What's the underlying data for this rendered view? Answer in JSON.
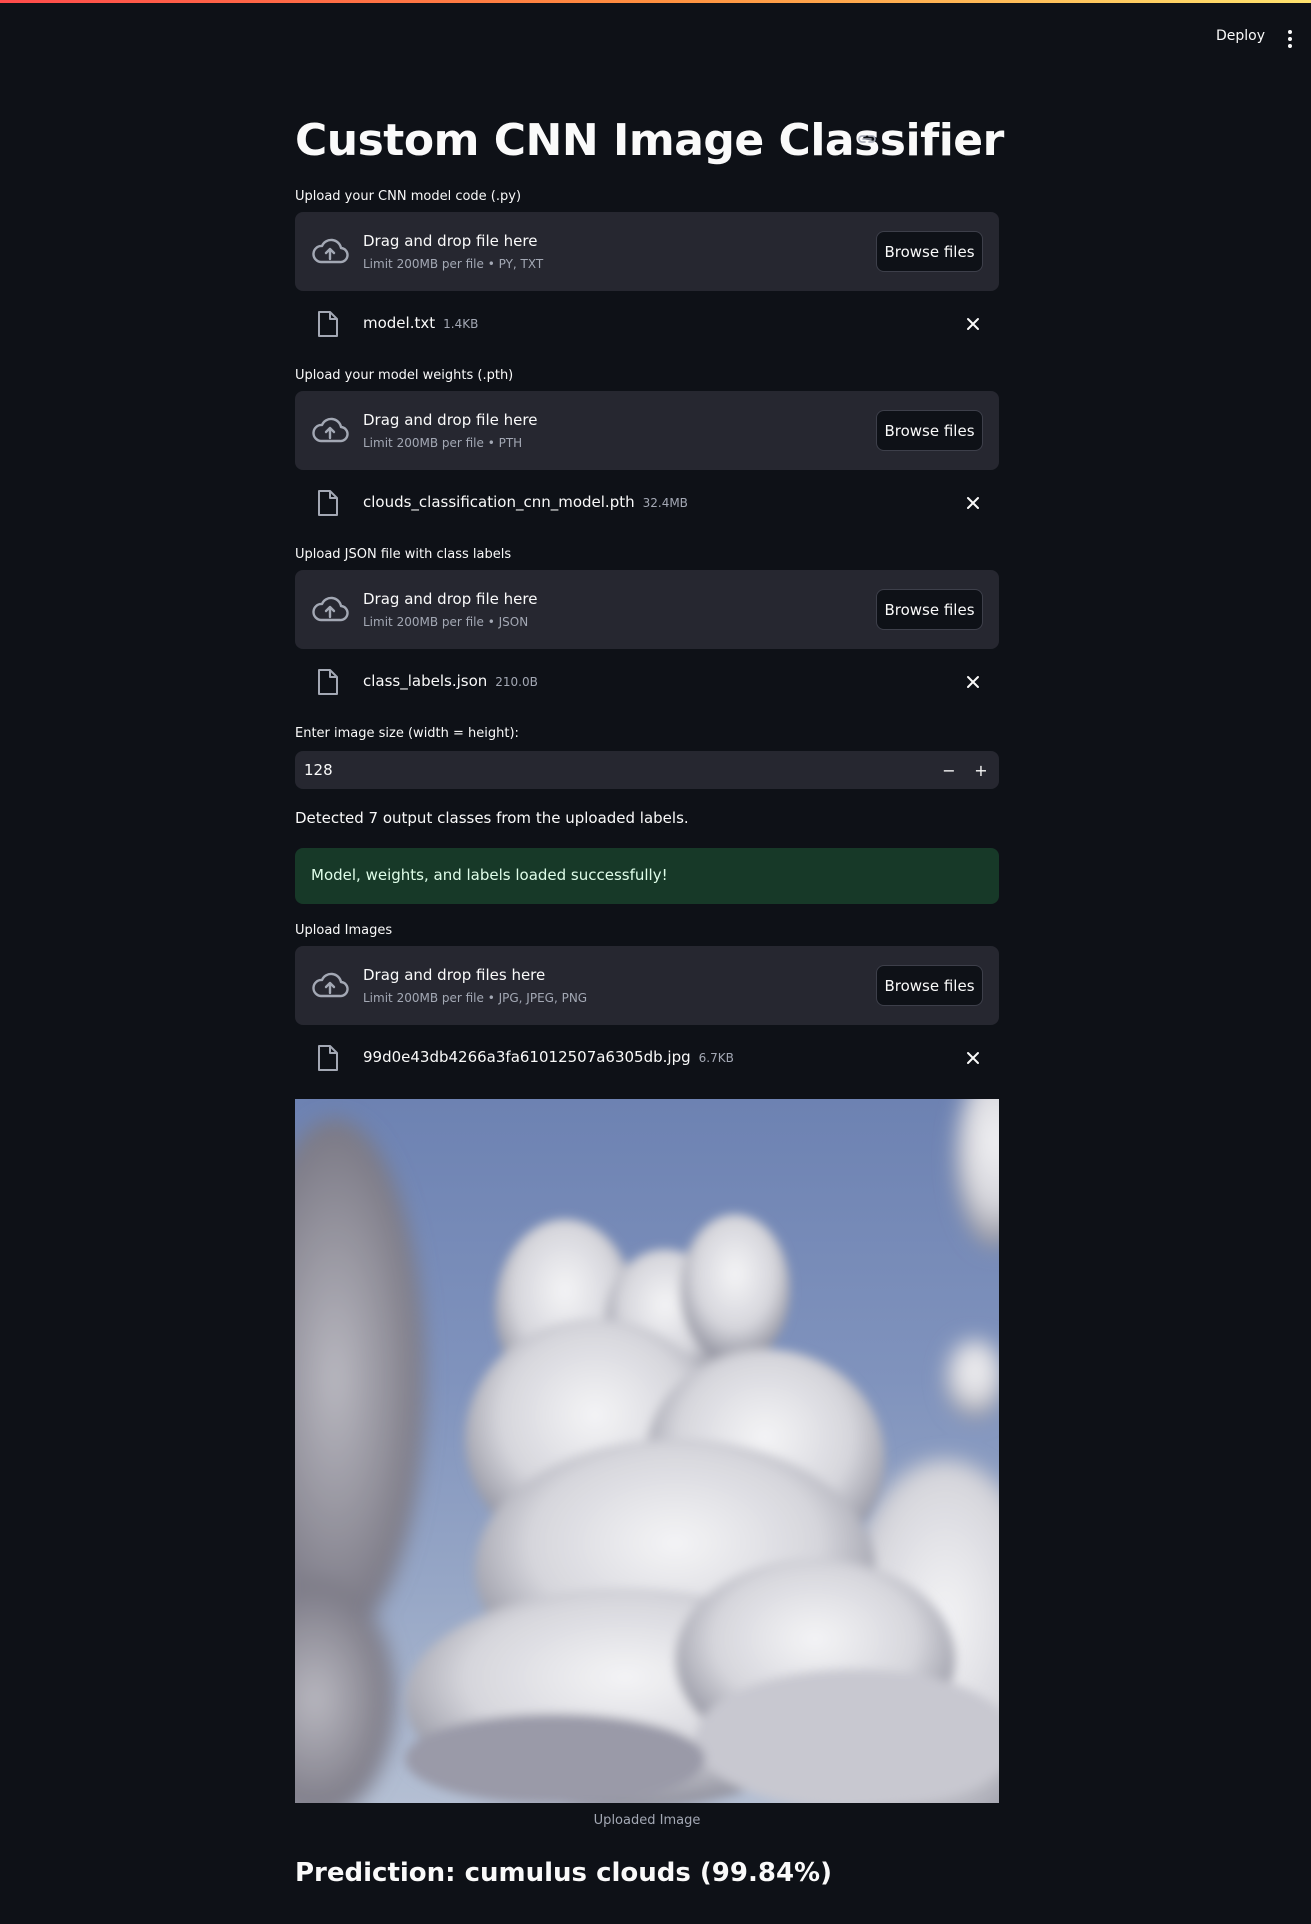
{
  "header": {
    "deploy_label": "Deploy"
  },
  "page": {
    "title": "Custom CNN Image Classifier"
  },
  "uploaders": [
    {
      "label": "Upload your CNN model code (.py)",
      "drop_text": "Drag and drop file here",
      "limit_text": "Limit 200MB per file • PY, TXT",
      "browse_label": "Browse files",
      "file_name": "model.txt",
      "file_size": "1.4KB"
    },
    {
      "label": "Upload your model weights (.pth)",
      "drop_text": "Drag and drop file here",
      "limit_text": "Limit 200MB per file • PTH",
      "browse_label": "Browse files",
      "file_name": "clouds_classification_cnn_model.pth",
      "file_size": "32.4MB"
    },
    {
      "label": "Upload JSON file with class labels",
      "drop_text": "Drag and drop file here",
      "limit_text": "Limit 200MB per file • JSON",
      "browse_label": "Browse files",
      "file_name": "class_labels.json",
      "file_size": "210.0B"
    },
    {
      "label": "Upload Images",
      "drop_text": "Drag and drop files here",
      "limit_text": "Limit 200MB per file • JPG, JPEG, PNG",
      "browse_label": "Browse files",
      "file_name": "99d0e43db4266a3fa61012507a6305db.jpg",
      "file_size": "6.7KB"
    }
  ],
  "image_size": {
    "label": "Enter image size (width = height):",
    "value": "128",
    "minus": "−",
    "plus": "+"
  },
  "detected_text": "Detected 7 output classes from the uploaded labels.",
  "success_text": "Model, weights, and labels loaded successfully!",
  "image_caption": "Uploaded Image",
  "prediction_text": "Prediction: cumulus clouds (99.84%)",
  "colors": {
    "background": "#0e1117",
    "panel": "#262730",
    "success_bg": "#173928",
    "accent_gradient_start": "#ff4b4b",
    "accent_gradient_end": "#ffe36e"
  }
}
